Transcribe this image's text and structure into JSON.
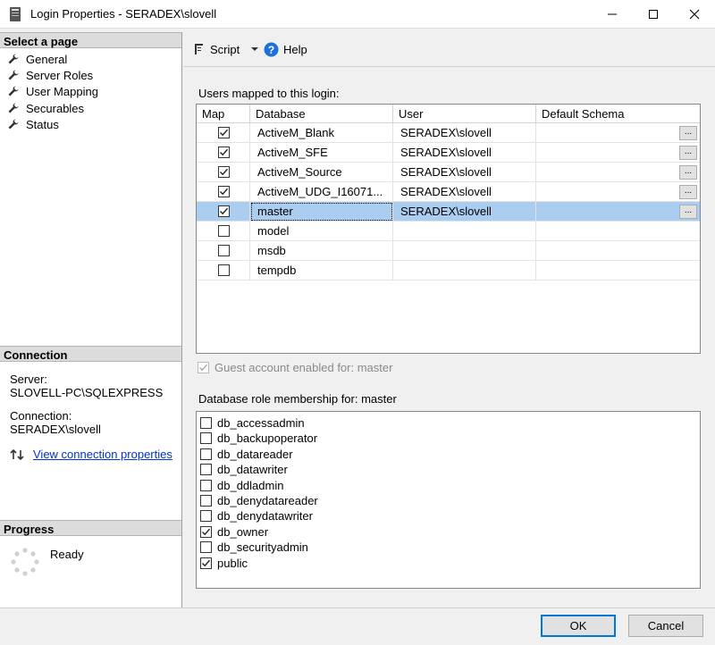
{
  "window": {
    "title": "Login Properties - SERADEX\\slovell"
  },
  "left_panel": {
    "select_page_header": "Select a page",
    "pages": [
      {
        "label": "General"
      },
      {
        "label": "Server Roles"
      },
      {
        "label": "User Mapping"
      },
      {
        "label": "Securables"
      },
      {
        "label": "Status"
      }
    ],
    "connection_header": "Connection",
    "server_label": "Server:",
    "server_value": "SLOVELL-PC\\SQLEXPRESS",
    "connection_label": "Connection:",
    "connection_value": "SERADEX\\slovell",
    "view_connection_link": "View connection properties",
    "progress_header": "Progress",
    "progress_status": "Ready"
  },
  "toolbar": {
    "script_label": "Script",
    "help_label": "Help"
  },
  "mapping": {
    "label": "Users mapped to this login:",
    "columns": [
      "Map",
      "Database",
      "User",
      "Default Schema"
    ],
    "rows": [
      {
        "map": true,
        "database": "ActiveM_Blank",
        "user": "SERADEX\\slovell",
        "schema": "",
        "has_button": true,
        "selected": false
      },
      {
        "map": true,
        "database": "ActiveM_SFE",
        "user": "SERADEX\\slovell",
        "schema": "",
        "has_button": true,
        "selected": false
      },
      {
        "map": true,
        "database": "ActiveM_Source",
        "user": "SERADEX\\slovell",
        "schema": "",
        "has_button": true,
        "selected": false
      },
      {
        "map": true,
        "database": "ActiveM_UDG_I16071...",
        "user": "SERADEX\\slovell",
        "schema": "",
        "has_button": true,
        "selected": false
      },
      {
        "map": true,
        "database": "master",
        "user": "SERADEX\\slovell",
        "schema": "",
        "has_button": true,
        "selected": true
      },
      {
        "map": false,
        "database": "model",
        "user": "",
        "schema": "",
        "has_button": false,
        "selected": false
      },
      {
        "map": false,
        "database": "msdb",
        "user": "",
        "schema": "",
        "has_button": false,
        "selected": false
      },
      {
        "map": false,
        "database": "tempdb",
        "user": "",
        "schema": "",
        "has_button": false,
        "selected": false
      }
    ],
    "ellipsis_label": "..."
  },
  "guest": {
    "label": "Guest account enabled for: master",
    "checked": true,
    "enabled": false
  },
  "roles": {
    "label": "Database role membership for: master",
    "items": [
      {
        "name": "db_accessadmin",
        "checked": false
      },
      {
        "name": "db_backupoperator",
        "checked": false
      },
      {
        "name": "db_datareader",
        "checked": false
      },
      {
        "name": "db_datawriter",
        "checked": false
      },
      {
        "name": "db_ddladmin",
        "checked": false
      },
      {
        "name": "db_denydatareader",
        "checked": false
      },
      {
        "name": "db_denydatawriter",
        "checked": false
      },
      {
        "name": "db_owner",
        "checked": true
      },
      {
        "name": "db_securityadmin",
        "checked": false
      },
      {
        "name": "public",
        "checked": true
      }
    ]
  },
  "buttons": {
    "ok": "OK",
    "cancel": "Cancel"
  },
  "colors": {
    "selection": "#abcdf0",
    "link": "#0033cc",
    "default_button_border": "#0078d7"
  }
}
